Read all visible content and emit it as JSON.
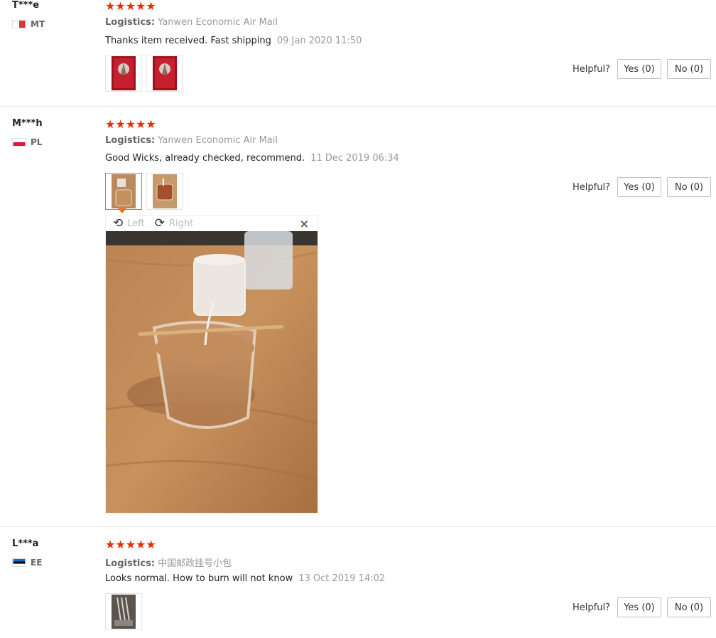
{
  "helpful_label": "Helpful?",
  "viewer": {
    "rotate_left": "Left",
    "rotate_right": "Right",
    "close_icon": "×"
  },
  "reviews": [
    {
      "user": "T***e",
      "country": "MT",
      "stars": "★★★★★",
      "logistics_label": "Logistics:",
      "logistics": "Yanwen Economic Air Mail",
      "feedback": "Thanks item received. Fast shipping",
      "date": "09 Jan 2020 11:50",
      "yes": "Yes (0)",
      "no": "No (0)"
    },
    {
      "user": "M***h",
      "country": "PL",
      "stars": "★★★★★",
      "logistics_label": "Logistics:",
      "logistics": "Yanwen Economic Air Mail",
      "feedback": "Good Wicks, already checked, recommend.",
      "date": "11 Dec 2019 06:34",
      "yes": "Yes (0)",
      "no": "No (0)"
    },
    {
      "user": "L***a",
      "country": "EE",
      "stars": "★★★★★",
      "logistics_label": "Logistics:",
      "logistics": "中国邮政挂号小包",
      "feedback": "Looks normal. How to burn will not know",
      "date": "13 Oct 2019 14:02",
      "yes": "Yes (0)",
      "no": "No (0)"
    }
  ],
  "colors": {
    "star": "#e62e04",
    "active_thumb": "#e5731f"
  }
}
